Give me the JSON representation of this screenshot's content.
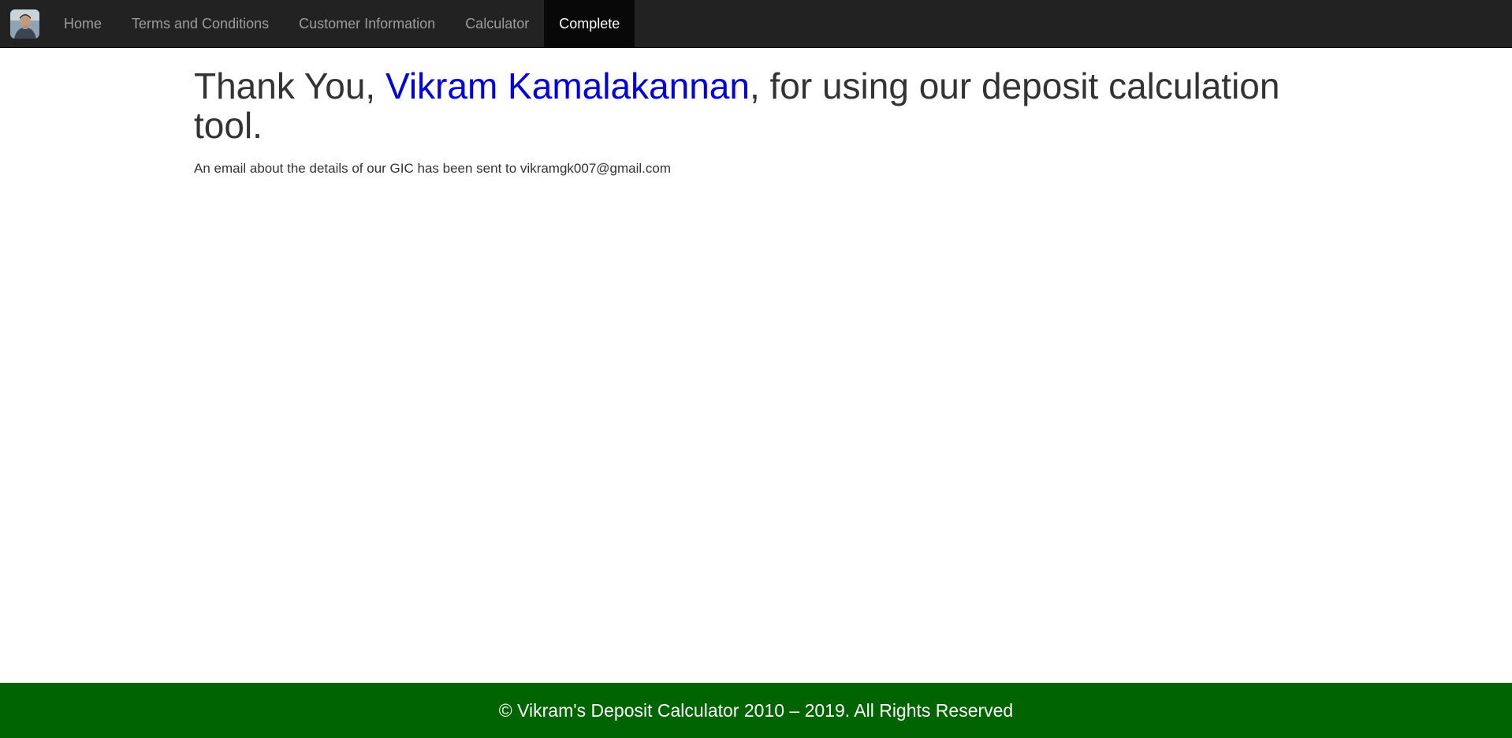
{
  "navbar": {
    "logo_icon": "user-avatar-icon",
    "items": [
      {
        "label": "Home"
      },
      {
        "label": "Terms and Conditions"
      },
      {
        "label": "Customer Information"
      },
      {
        "label": "Calculator"
      },
      {
        "label": "Complete"
      }
    ],
    "active_item": "Complete",
    "colors": {
      "background": "#222222",
      "active_background": "#080808",
      "item_text": "#9d9d9d",
      "active_text": "#ffffff"
    }
  },
  "main": {
    "heading_prefix": "Thank You, ",
    "customer_name": "Vikram Kamalakannan",
    "heading_suffix": ", for using our deposit calculation tool.",
    "email_note": "An email about the details of our GIC has been sent to vikramgk007@gmail.com",
    "colors": {
      "name": "#0000ee",
      "text": "#333333"
    }
  },
  "footer": {
    "text": "© Vikram's Deposit Calculator 2010 – 2019. All Rights Reserved",
    "background": "#006400"
  }
}
